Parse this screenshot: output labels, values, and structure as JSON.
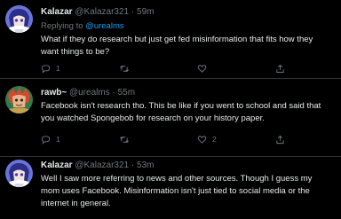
{
  "tweets": [
    {
      "name": "Kalazar",
      "handle": "@Kalazar321",
      "separator": "·",
      "time": "59m",
      "replying_prefix": "Replying to ",
      "replying_mention": "@urealms",
      "lines": [
        "What if they do research but just get fed misinformation that fits how they",
        "want things to be?"
      ],
      "reply_count": "1",
      "retweet_count": "",
      "like_count": "",
      "avatar_icon": "kalazar-avatar"
    },
    {
      "name": "rawb~",
      "handle": "@urealms",
      "separator": "·",
      "time": "55m",
      "lines": [
        "Facebook isn't research tho. This be like if you went to school and said that",
        "you watched Spongebob for research on your history paper."
      ],
      "reply_count": "1",
      "retweet_count": "",
      "like_count": "2",
      "avatar_icon": "rawb-avatar"
    },
    {
      "name": "Kalazar",
      "handle": "@Kalazar321",
      "separator": "·",
      "time": "53m",
      "lines": [
        "Well I saw more referring to news and other sources. Though I guess my",
        "mom uses Facebook. Misinformation isn't just tied to social media or the",
        "internet in general."
      ],
      "avatar_icon": "kalazar-avatar"
    }
  ],
  "colors": {
    "background": "#000000",
    "text": "#e7e9ea",
    "muted": "#71767b",
    "link": "#1d9bf0",
    "divider": "#2f3336"
  }
}
